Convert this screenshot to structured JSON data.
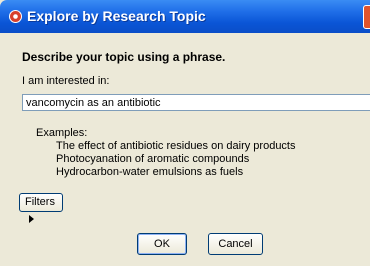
{
  "window": {
    "title": "Explore by Research Topic"
  },
  "form": {
    "heading": "Describe your topic using a phrase.",
    "label": "I am interested in:",
    "topic_value": "vancomycin as an antibiotic"
  },
  "examples": {
    "label": "Examples:",
    "items": [
      "The effect of antibiotic residues on dairy products",
      "Photocyanation of aromatic compounds",
      "Hydrocarbon-water emulsions as fuels"
    ]
  },
  "buttons": {
    "filters": "Filters",
    "ok": "OK",
    "cancel": "Cancel"
  }
}
